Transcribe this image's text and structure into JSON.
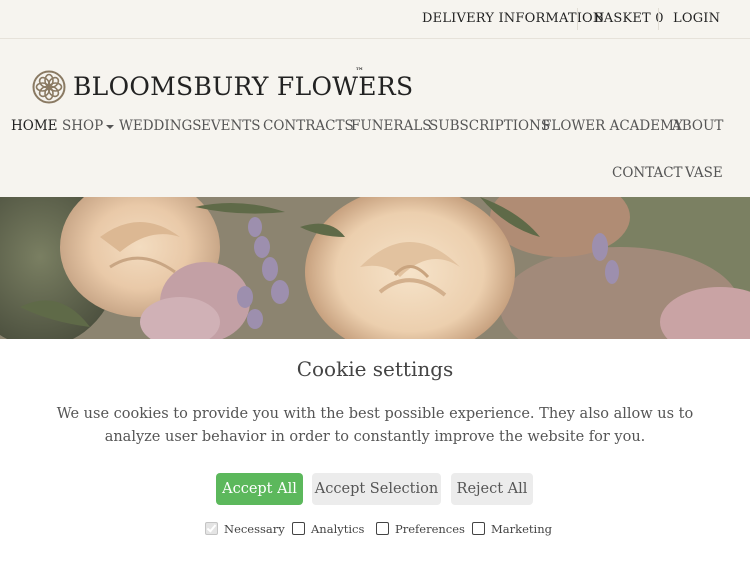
{
  "topbar": {
    "delivery": "DELIVERY INFORMATION",
    "basket": "BASKET",
    "basket_count": "0",
    "login": "LOGIN"
  },
  "brand": {
    "name": "BLOOMSBURY FLOWERS",
    "tm": "™",
    "logo_icon": "rosette-icon"
  },
  "nav": {
    "items": [
      "HOME",
      "SHOP",
      "WEDDINGS",
      "EVENTS",
      "CONTRACTS",
      "FUNERALS",
      "SUBSCRIPTIONS",
      "FLOWER ACADEMY",
      "ABOUT"
    ],
    "row2": [
      "CONTACT",
      "VASE"
    ]
  },
  "cookie": {
    "title": "Cookie settings",
    "text": "We use cookies to provide you with the best possible experience. They also allow us to analyze user behavior in order to constantly improve the website for you.",
    "buttons": {
      "accept_all": "Accept All",
      "accept_selection": "Accept Selection",
      "reject_all": "Reject All"
    },
    "options": [
      {
        "label": "Necessary",
        "checked": true,
        "disabled": true
      },
      {
        "label": "Analytics",
        "checked": false,
        "disabled": false
      },
      {
        "label": "Preferences",
        "checked": false,
        "disabled": false
      },
      {
        "label": "Marketing",
        "checked": false,
        "disabled": false
      }
    ]
  },
  "colors": {
    "accent_green": "#5cb85c",
    "page_bg": "#f6f4ef",
    "button_grey": "#ececec"
  }
}
